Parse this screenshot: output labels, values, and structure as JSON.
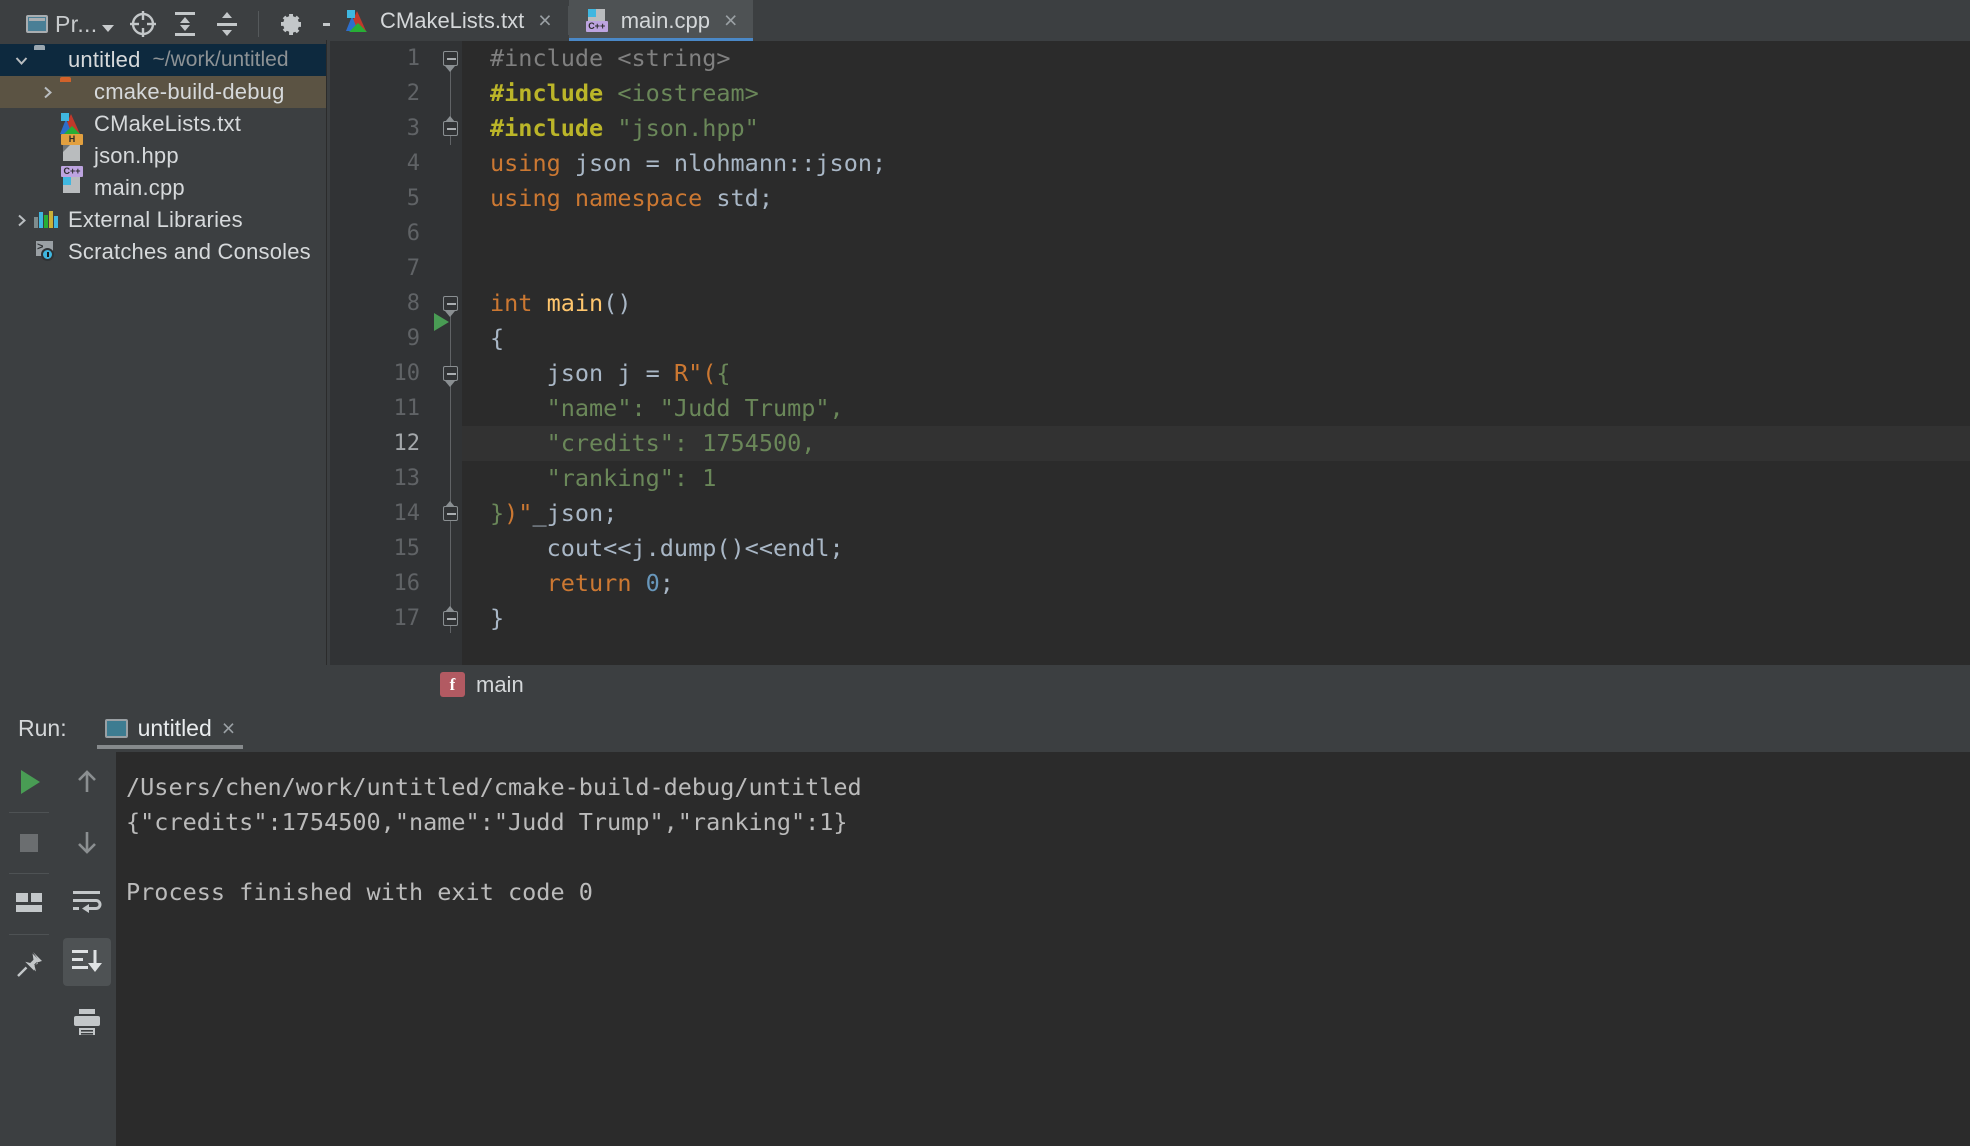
{
  "toolbar": {
    "project_label": "Pr...",
    "icons": [
      {
        "name": "project-window-icon",
        "glyph": "window"
      },
      {
        "name": "target-crosshair-icon",
        "glyph": "crosshair"
      },
      {
        "name": "expand-all-icon",
        "glyph": "expand"
      },
      {
        "name": "collapse-all-icon",
        "glyph": "collapse"
      },
      {
        "name": "settings-gear-icon",
        "glyph": "gear"
      },
      {
        "name": "hide-icon",
        "glyph": "minus"
      }
    ]
  },
  "project_tree": [
    {
      "label": "untitled",
      "path": "~/work/untitled",
      "icon": "folder-icon",
      "arrow": "chevron-down",
      "state": "selected-blue",
      "indent": 0
    },
    {
      "label": "cmake-build-debug",
      "path": "",
      "icon": "folder-orange-icon",
      "arrow": "chevron-right",
      "state": "selected-olive",
      "indent": 1
    },
    {
      "label": "CMakeLists.txt",
      "path": "",
      "icon": "cmake-file-icon",
      "arrow": "",
      "state": "",
      "indent": 1
    },
    {
      "label": "json.hpp",
      "path": "",
      "icon": "header-file-icon",
      "arrow": "",
      "state": "",
      "indent": 1
    },
    {
      "label": "main.cpp",
      "path": "",
      "icon": "cpp-file-icon",
      "arrow": "",
      "state": "",
      "indent": 1
    },
    {
      "label": "External Libraries",
      "path": "",
      "icon": "libraries-icon",
      "arrow": "chevron-right",
      "state": "",
      "indent": 0
    },
    {
      "label": "Scratches and Consoles",
      "path": "",
      "icon": "scratches-icon",
      "arrow": "",
      "state": "",
      "indent": 0
    }
  ],
  "editor_tabs": [
    {
      "label": "CMakeLists.txt",
      "icon": "cmake-file-icon",
      "active": false,
      "close": "×"
    },
    {
      "label": "main.cpp",
      "icon": "cpp-file-icon",
      "active": true,
      "close": "×"
    }
  ],
  "editor": {
    "lines": [
      {
        "n": "1",
        "tokens": [
          {
            "t": "#include <string>",
            "c": "s-gray"
          }
        ]
      },
      {
        "n": "2",
        "tokens": [
          {
            "t": "#include ",
            "c": "s-macro"
          },
          {
            "t": "<iostream>",
            "c": "s-str"
          }
        ]
      },
      {
        "n": "3",
        "tokens": [
          {
            "t": "#include ",
            "c": "s-macro"
          },
          {
            "t": "\"json.hpp\"",
            "c": "s-str"
          }
        ]
      },
      {
        "n": "4",
        "tokens": [
          {
            "t": "using ",
            "c": "s-key"
          },
          {
            "t": "json = nlohmann::json;",
            "c": "s-txt"
          }
        ]
      },
      {
        "n": "5",
        "tokens": [
          {
            "t": "using namespace ",
            "c": "s-key"
          },
          {
            "t": "std;",
            "c": "s-txt"
          }
        ]
      },
      {
        "n": "6",
        "tokens": []
      },
      {
        "n": "7",
        "tokens": []
      },
      {
        "n": "8",
        "tokens": [
          {
            "t": "int ",
            "c": "s-key"
          },
          {
            "t": "main",
            "c": "s-fn"
          },
          {
            "t": "()",
            "c": "s-txt"
          }
        ]
      },
      {
        "n": "9",
        "tokens": [
          {
            "t": "{",
            "c": "s-txt"
          }
        ]
      },
      {
        "n": "10",
        "tokens": [
          {
            "t": "    json j = ",
            "c": "s-txt"
          },
          {
            "t": "R\"(",
            "c": "s-key"
          },
          {
            "t": "{",
            "c": "s-str"
          }
        ]
      },
      {
        "n": "11",
        "tokens": [
          {
            "t": "    \"name\": \"Judd Trump\",",
            "c": "s-str"
          }
        ]
      },
      {
        "n": "12",
        "tokens": [
          {
            "t": "    \"credits\": 1754500,",
            "c": "s-str"
          }
        ]
      },
      {
        "n": "13",
        "tokens": [
          {
            "t": "    \"ranking\": 1",
            "c": "s-str"
          }
        ]
      },
      {
        "n": "14",
        "tokens": [
          {
            "t": "}",
            "c": "s-str"
          },
          {
            "t": ")\"",
            "c": "s-key"
          },
          {
            "t": "_json;",
            "c": "s-txt"
          }
        ]
      },
      {
        "n": "15",
        "tokens": [
          {
            "t": "    cout<<j.dump()<<endl;",
            "c": "s-txt"
          }
        ]
      },
      {
        "n": "16",
        "tokens": [
          {
            "t": "    ",
            "c": "s-txt"
          },
          {
            "t": "return ",
            "c": "s-key"
          },
          {
            "t": "0",
            "c": "s-num"
          },
          {
            "t": ";",
            "c": "s-txt"
          }
        ]
      },
      {
        "n": "17",
        "tokens": [
          {
            "t": "}",
            "c": "s-txt"
          }
        ]
      }
    ],
    "current_line": "12",
    "run_marker_line": "8"
  },
  "breadcrumb": {
    "icon_letter": "f",
    "label": "main"
  },
  "run_panel": {
    "title": "Run:",
    "tab_label": "untitled",
    "tab_close": "×",
    "console": [
      "/Users/chen/work/untitled/cmake-build-debug/untitled",
      "{\"credits\":1754500,\"name\":\"Judd Trump\",\"ranking\":1}",
      "",
      "Process finished with exit code 0"
    ],
    "tools_col1": [
      {
        "name": "rerun-button",
        "glyph": "play"
      },
      {
        "name": "stop-button",
        "glyph": "stop"
      },
      {
        "name": "layout-button",
        "glyph": "layout"
      },
      {
        "name": "pin-tab-button",
        "glyph": "pin"
      }
    ],
    "tools_col2": [
      {
        "name": "up-arrow-button",
        "glyph": "up"
      },
      {
        "name": "down-arrow-button",
        "glyph": "down"
      },
      {
        "name": "soft-wrap-button",
        "glyph": "wrap"
      },
      {
        "name": "scroll-to-end-button",
        "glyph": "scroll-end",
        "active": true
      },
      {
        "name": "print-button",
        "glyph": "print"
      }
    ]
  },
  "colors": {
    "accent_blue": "#4a88c7",
    "editor_bg": "#2b2b2b",
    "panel_bg": "#3c3f41",
    "selection_blue": "#0d293e",
    "selection_olive": "#5b5343",
    "green_run": "#499c54"
  }
}
